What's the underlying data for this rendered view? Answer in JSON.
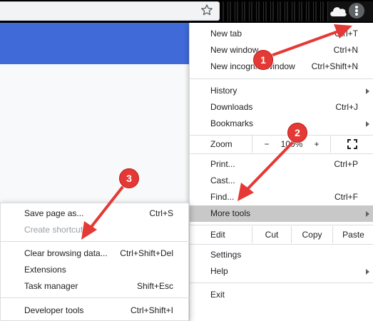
{
  "colors": {
    "accent": "#e53935",
    "banner": "#3f6ad8",
    "highlight": "#c8c8c8"
  },
  "toolbar": {
    "star_icon": "star-icon",
    "profile_icon": "cloud-icon",
    "menu_icon": "kebab-menu-icon"
  },
  "menu": {
    "items": [
      {
        "label": "New tab",
        "shortcut": "Ctrl+T"
      },
      {
        "label": "New window",
        "shortcut": "Ctrl+N"
      },
      {
        "label": "New incognito window",
        "shortcut": "Ctrl+Shift+N"
      },
      {
        "label": "History",
        "shortcut": ""
      },
      {
        "label": "Downloads",
        "shortcut": "Ctrl+J"
      },
      {
        "label": "Bookmarks",
        "shortcut": ""
      },
      {
        "label": "Print...",
        "shortcut": "Ctrl+P"
      },
      {
        "label": "Cast...",
        "shortcut": ""
      },
      {
        "label": "Find...",
        "shortcut": "Ctrl+F"
      },
      {
        "label": "More tools",
        "shortcut": ""
      },
      {
        "label": "Settings",
        "shortcut": ""
      },
      {
        "label": "Help",
        "shortcut": ""
      },
      {
        "label": "Exit",
        "shortcut": ""
      }
    ],
    "zoom": {
      "label": "Zoom",
      "minus": "−",
      "value": "100%",
      "plus": "+"
    },
    "edit": {
      "label": "Edit",
      "cut": "Cut",
      "copy": "Copy",
      "paste": "Paste"
    }
  },
  "submenu": {
    "items": [
      {
        "label": "Save page as...",
        "shortcut": "Ctrl+S"
      },
      {
        "label": "Create shortcut...",
        "shortcut": ""
      },
      {
        "label": "Clear browsing data...",
        "shortcut": "Ctrl+Shift+Del"
      },
      {
        "label": "Extensions",
        "shortcut": ""
      },
      {
        "label": "Task manager",
        "shortcut": "Shift+Esc"
      },
      {
        "label": "Developer tools",
        "shortcut": "Ctrl+Shift+I"
      }
    ]
  },
  "annotations": {
    "step1": "1",
    "step2": "2",
    "step3": "3"
  }
}
